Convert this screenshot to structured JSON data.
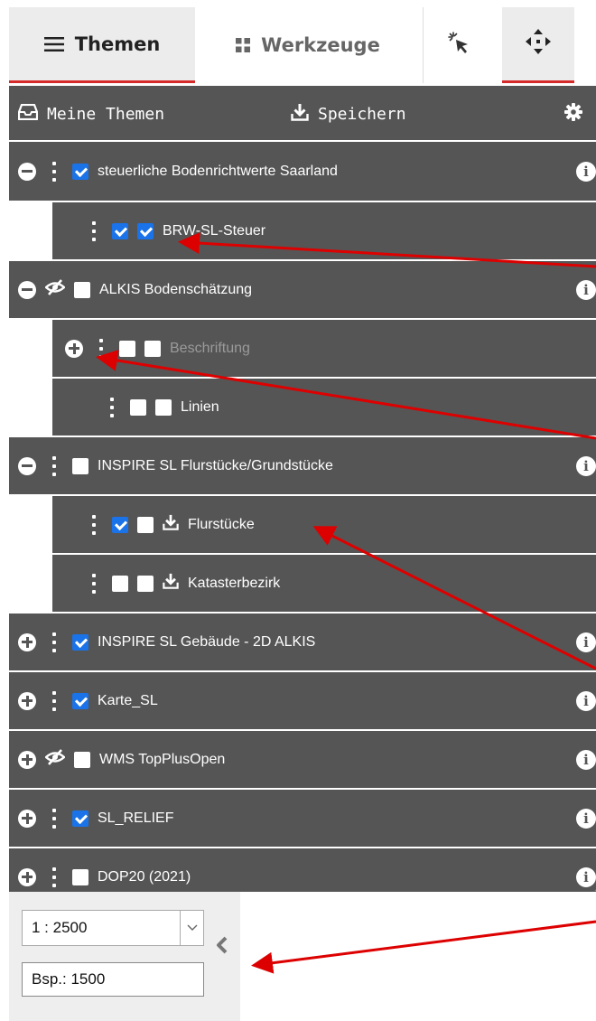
{
  "tabs": [
    {
      "label": "Themen",
      "icon": "menu-icon",
      "active": true
    },
    {
      "label": "Werkzeuge",
      "icon": "grid-icon",
      "active": false
    },
    {
      "icon": "pointer-select-icon"
    },
    {
      "icon": "move-icon"
    }
  ],
  "toolbar": {
    "my_themes_label": "Meine Themen",
    "save_label": "Speichern"
  },
  "layers": [
    {
      "label": "steuerliche Bodenrichtwerte Saarland",
      "expander": "minus",
      "handle": "dots",
      "checked": true,
      "info": true
    },
    {
      "label": "BRW-SL-Steuer",
      "level": 1,
      "handle": "dots",
      "checked": true,
      "checked2": true
    },
    {
      "label": "ALKIS Bodenschätzung",
      "expander": "minus",
      "handle": "hidden-eye",
      "checked": false,
      "info": true
    },
    {
      "label": "Beschriftung",
      "level": 1,
      "expander": "plus",
      "handle": "dots",
      "checked": false,
      "checked2": false,
      "disabled": true
    },
    {
      "label": "Linien",
      "level": 2,
      "handle": "dots",
      "checked": false,
      "checked2": false
    },
    {
      "label": "INSPIRE SL Flurstücke/Grundstücke",
      "expander": "minus",
      "handle": "dots",
      "checked": false,
      "info": true
    },
    {
      "label": "Flurstücke",
      "level": 1,
      "handle": "dots",
      "checked": true,
      "checked2": false,
      "download": true
    },
    {
      "label": "Katasterbezirk",
      "level": 1,
      "handle": "dots",
      "checked": false,
      "checked2": false,
      "download": true
    },
    {
      "label": "INSPIRE SL Gebäude - 2D ALKIS",
      "expander": "plus",
      "handle": "dots",
      "checked": true,
      "info": true
    },
    {
      "label": "Karte_SL",
      "expander": "plus",
      "handle": "dots",
      "checked": true,
      "info": true
    },
    {
      "label": "WMS TopPlusOpen",
      "expander": "plus",
      "handle": "hidden-eye",
      "checked": false,
      "info": true
    },
    {
      "label": "SL_RELIEF",
      "expander": "plus",
      "handle": "dots",
      "checked": true,
      "info": true
    },
    {
      "label": "DOP20 (2021)",
      "expander": "plus",
      "handle": "dots",
      "checked": false,
      "info": true
    }
  ],
  "scale": {
    "selected": "1 : 2500",
    "input_placeholder": "Bsp.: 1500"
  },
  "colors": {
    "panel": "#555555",
    "checkbox_checked": "#1a73e8",
    "tab_active_underline": "#d42a2a",
    "annotation_arrow": "#dd0000"
  }
}
